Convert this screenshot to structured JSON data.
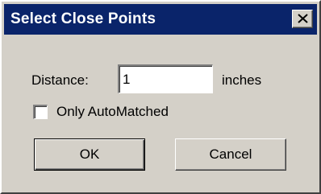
{
  "window": {
    "title": "Select Close Points",
    "close_icon": "close-icon"
  },
  "form": {
    "distance_label": "Distance:",
    "distance_value": "1",
    "units_label": "inches",
    "only_automatched_label": "Only AutoMatched",
    "only_automatched_checked": false
  },
  "buttons": {
    "ok_label": "OK",
    "cancel_label": "Cancel"
  },
  "colors": {
    "titlebar": "#0a246a",
    "dialog_face": "#d4d0c8"
  }
}
